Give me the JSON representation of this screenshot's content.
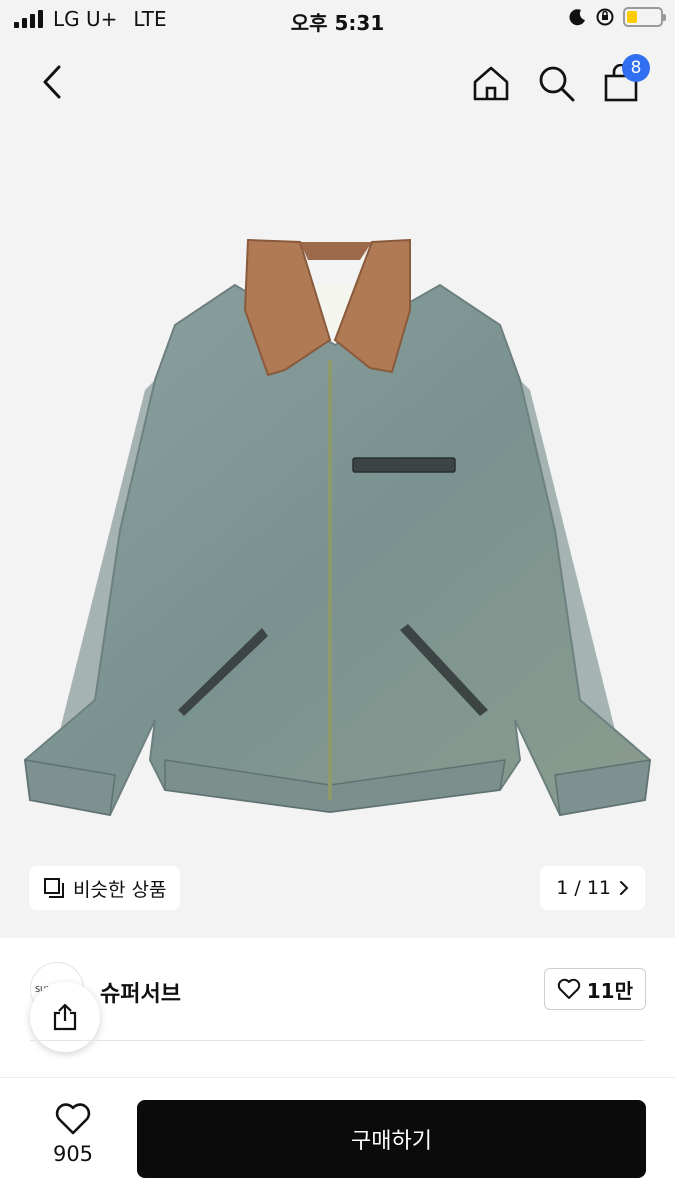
{
  "status_bar": {
    "carrier": "LG U+",
    "network": "LTE",
    "time": "오후 5:31"
  },
  "nav": {
    "back_icon": "chevron-left-icon",
    "home_icon": "home-icon",
    "search_icon": "search-icon",
    "bag_icon": "shopping-bag-icon",
    "bag_count": "8"
  },
  "gallery": {
    "similar_label": "비슷한 상품",
    "similar_icon": "copy-icon",
    "pager": "1 / 11"
  },
  "shop": {
    "name": "슈퍼서브",
    "logo_text": "SUPERSU",
    "likes": "11만"
  },
  "bottom_bar": {
    "wish_count": "905",
    "buy_label": "구매하기"
  },
  "colors": {
    "badge": "#2f6ff0",
    "buy_button": "#0b0b0b",
    "denim": "#7f9696",
    "collar": "#b07a55"
  }
}
